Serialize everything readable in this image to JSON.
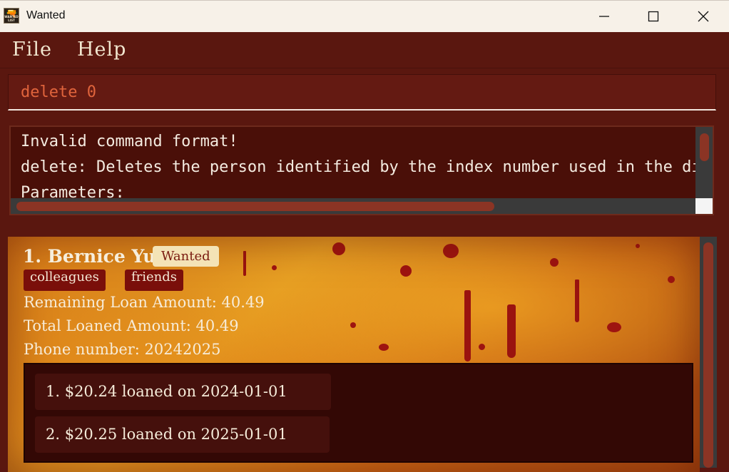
{
  "window": {
    "title": "Wanted",
    "icon": "wanted-list-app-icon",
    "icon_text": "WANTED LIST"
  },
  "menu": {
    "items": [
      "File",
      "Help"
    ]
  },
  "command": {
    "value": "delete 0"
  },
  "result": {
    "lines": [
      "Invalid command format!",
      "delete: Deletes the person identified by the index number used in the displayed person list.",
      "Parameters:"
    ]
  },
  "list": {
    "cards": [
      {
        "index_name": "1. Bernice Yu",
        "badge": "Wanted",
        "tags": [
          "colleagues",
          "friends"
        ],
        "fields": [
          "Remaining Loan Amount: 40.49",
          "Total Loaned Amount: 40.49",
          "Phone number: 20242025"
        ],
        "loans": [
          "1. $20.24 loaned on 2024-01-01",
          "2. $20.25 loaned on 2025-01-01"
        ]
      }
    ]
  },
  "colors": {
    "window_bg": "#5a170f",
    "command_text": "#e0643c",
    "tag_bg": "#7a0f0a",
    "badge_bg": "#f4e3b6",
    "scroll_thumb": "#8b3424"
  }
}
